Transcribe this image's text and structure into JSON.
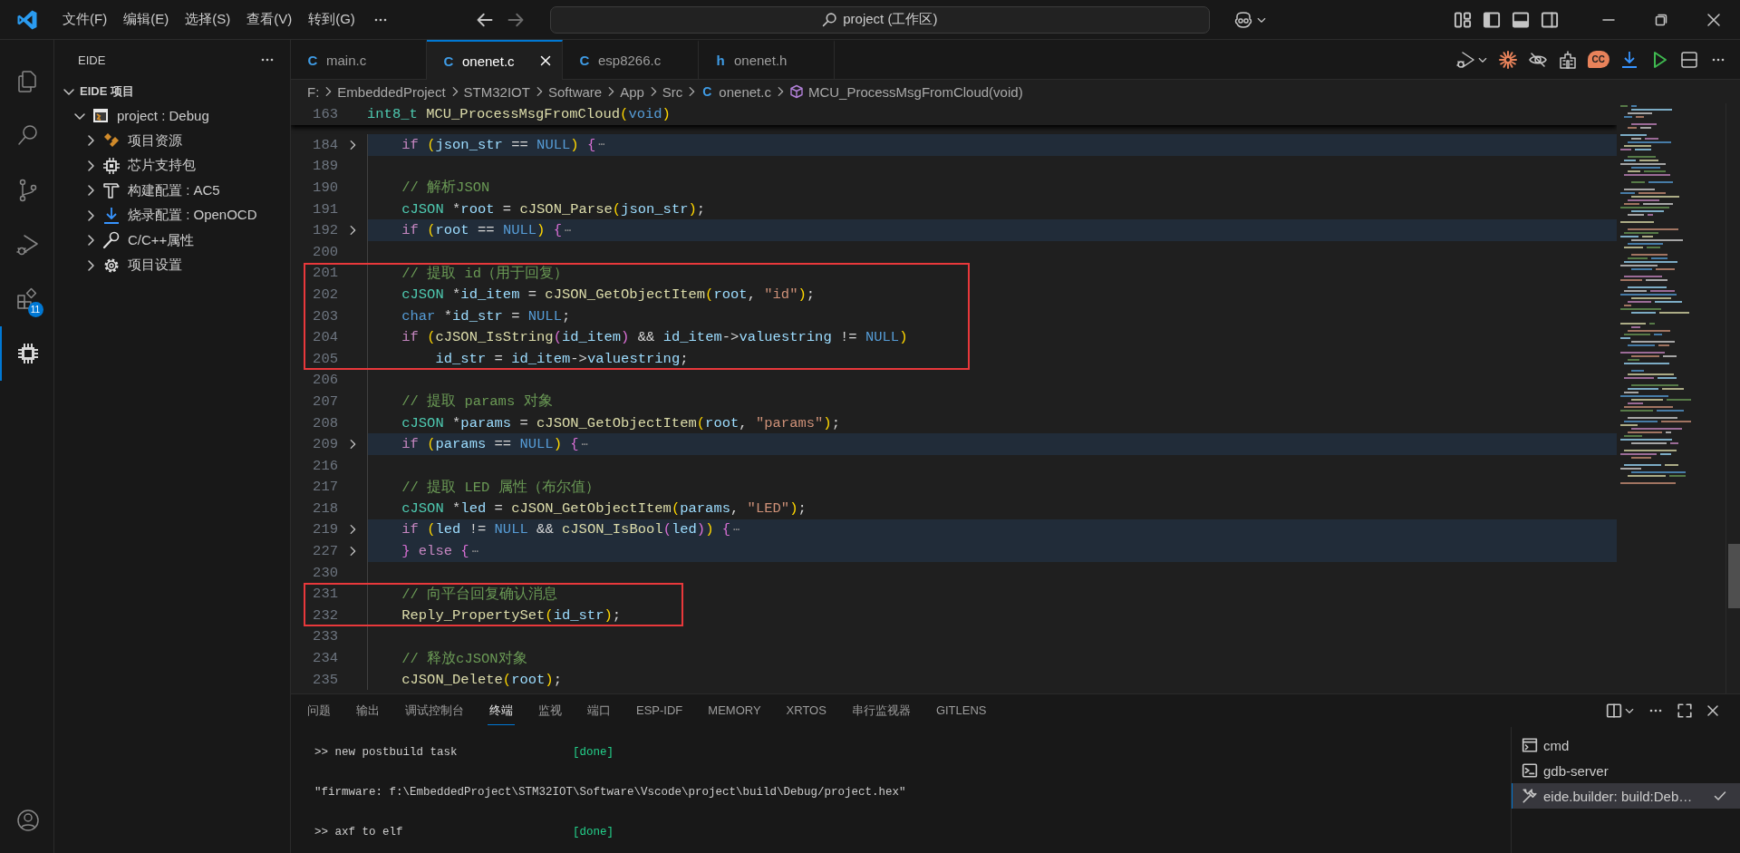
{
  "title_bar": {
    "menus": [
      "文件(F)",
      "编辑(E)",
      "选择(S)",
      "查看(V)",
      "转到(G)"
    ],
    "command_center": "project (工作区)"
  },
  "activity_bar": {
    "items": [
      {
        "kind": "explorer",
        "selected": false
      },
      {
        "kind": "search",
        "selected": false
      },
      {
        "kind": "source_control",
        "selected": false
      },
      {
        "kind": "run_debug",
        "selected": false
      },
      {
        "kind": "extensions",
        "selected": false,
        "badge": "11"
      },
      {
        "kind": "eide",
        "selected": true
      }
    ]
  },
  "sidebar": {
    "title": "EIDE",
    "section": {
      "label": "EIDE 项目",
      "expanded": true
    },
    "tree": [
      {
        "label": "project : Debug",
        "kind": "project",
        "expanded": true,
        "children": [
          {
            "label": "项目资源",
            "kind": "resources",
            "expanded": false
          },
          {
            "label": "芯片支持包",
            "kind": "chip",
            "expanded": false
          },
          {
            "label": "构建配置 : AC5",
            "kind": "build",
            "expanded": false
          },
          {
            "label": "烧录配置 : OpenOCD",
            "kind": "flash",
            "expanded": false
          },
          {
            "label": "C/C++属性",
            "kind": "key",
            "expanded": false
          },
          {
            "label": "项目设置",
            "kind": "settings",
            "expanded": false
          }
        ]
      }
    ]
  },
  "editor": {
    "tabs": [
      {
        "icon": "C",
        "label": "main.c",
        "selected": false
      },
      {
        "icon": "C",
        "label": "onenet.c",
        "selected": true
      },
      {
        "icon": "C",
        "label": "esp8266.c",
        "selected": false
      },
      {
        "icon": "h",
        "label": "onenet.h",
        "selected": false
      }
    ],
    "toolbar": {
      "bubble_label": "CC"
    },
    "breadcrumb": [
      {
        "kind": "folder",
        "label": "F:"
      },
      {
        "kind": "folder",
        "label": "EmbeddedProject"
      },
      {
        "kind": "folder",
        "label": "STM32IOT"
      },
      {
        "kind": "folder",
        "label": "Software"
      },
      {
        "kind": "folder",
        "label": "App"
      },
      {
        "kind": "folder",
        "label": "Src"
      },
      {
        "kind": "file",
        "icon": "C",
        "label": "onenet.c"
      },
      {
        "kind": "symbol",
        "label": "MCU_ProcessMsgFromCloud(void)"
      }
    ],
    "sticky_line": {
      "num": "163",
      "tokens": [
        {
          "kind": "type",
          "text": "int8_t "
        },
        {
          "kind": "function",
          "text": "MCU_ProcessMsgFromCloud"
        },
        {
          "kind": "bracket1",
          "text": "("
        },
        {
          "kind": "constant",
          "text": "void"
        },
        {
          "kind": "bracket1",
          "text": ")"
        }
      ]
    },
    "lines": [
      {
        "num": "184",
        "folded": true,
        "framed": false,
        "tokens": [
          {
            "kind": "keyword",
            "text": "    if "
          },
          {
            "kind": "bracket1",
            "text": "("
          },
          {
            "kind": "variable",
            "text": "json_str"
          },
          {
            "kind": "plain",
            "text": " == "
          },
          {
            "kind": "constant",
            "text": "NULL"
          },
          {
            "kind": "bracket1",
            "text": ") "
          },
          {
            "kind": "bracket2",
            "text": "{"
          },
          {
            "kind": "fold",
            "text": "⋯"
          }
        ]
      },
      {
        "num": "189",
        "folded": false,
        "framed": false
      },
      {
        "num": "190",
        "folded": false,
        "framed": false,
        "tokens": [
          {
            "kind": "comment",
            "text": "    // 解析JSON"
          }
        ]
      },
      {
        "num": "191",
        "folded": false,
        "framed": false,
        "tokens": [
          {
            "kind": "type",
            "text": "    cJSON"
          },
          {
            "kind": "plain",
            "text": " *"
          },
          {
            "kind": "variable",
            "text": "root"
          },
          {
            "kind": "plain",
            "text": " = "
          },
          {
            "kind": "function",
            "text": "cJSON_Parse"
          },
          {
            "kind": "bracket1",
            "text": "("
          },
          {
            "kind": "variable",
            "text": "json_str"
          },
          {
            "kind": "bracket1",
            "text": ")"
          },
          {
            "kind": "plain",
            "text": ";"
          }
        ]
      },
      {
        "num": "192",
        "folded": true,
        "framed": false,
        "tokens": [
          {
            "kind": "keyword",
            "text": "    if "
          },
          {
            "kind": "bracket1",
            "text": "("
          },
          {
            "kind": "variable",
            "text": "root"
          },
          {
            "kind": "plain",
            "text": " == "
          },
          {
            "kind": "constant",
            "text": "NULL"
          },
          {
            "kind": "bracket1",
            "text": ") "
          },
          {
            "kind": "bracket2",
            "text": "{"
          },
          {
            "kind": "fold",
            "text": "⋯"
          }
        ]
      },
      {
        "num": "200",
        "folded": false,
        "framed": false
      },
      {
        "num": "201",
        "folded": false,
        "framed": true,
        "tokens": [
          {
            "kind": "comment",
            "text": "    // 提取 id（用于回复）"
          }
        ]
      },
      {
        "num": "202",
        "folded": false,
        "framed": true,
        "tokens": [
          {
            "kind": "type",
            "text": "    cJSON"
          },
          {
            "kind": "plain",
            "text": " *"
          },
          {
            "kind": "variable",
            "text": "id_item"
          },
          {
            "kind": "plain",
            "text": " = "
          },
          {
            "kind": "function",
            "text": "cJSON_GetObjectItem"
          },
          {
            "kind": "bracket1",
            "text": "("
          },
          {
            "kind": "variable",
            "text": "root"
          },
          {
            "kind": "plain",
            "text": ", "
          },
          {
            "kind": "string",
            "text": "\"id\""
          },
          {
            "kind": "bracket1",
            "text": ")"
          },
          {
            "kind": "plain",
            "text": ";"
          }
        ]
      },
      {
        "num": "203",
        "folded": false,
        "framed": true,
        "tokens": [
          {
            "kind": "constant",
            "text": "    char"
          },
          {
            "kind": "plain",
            "text": " *"
          },
          {
            "kind": "variable",
            "text": "id_str"
          },
          {
            "kind": "plain",
            "text": " = "
          },
          {
            "kind": "constant",
            "text": "NULL"
          },
          {
            "kind": "plain",
            "text": ";"
          }
        ]
      },
      {
        "num": "204",
        "folded": false,
        "framed": true,
        "tokens": [
          {
            "kind": "keyword",
            "text": "    if "
          },
          {
            "kind": "bracket1",
            "text": "("
          },
          {
            "kind": "function",
            "text": "cJSON_IsString"
          },
          {
            "kind": "bracket2",
            "text": "("
          },
          {
            "kind": "variable",
            "text": "id_item"
          },
          {
            "kind": "bracket2",
            "text": ")"
          },
          {
            "kind": "plain",
            "text": " && "
          },
          {
            "kind": "variable",
            "text": "id_item"
          },
          {
            "kind": "plain",
            "text": "->"
          },
          {
            "kind": "variable",
            "text": "valuestring"
          },
          {
            "kind": "plain",
            "text": " != "
          },
          {
            "kind": "constant",
            "text": "NULL"
          },
          {
            "kind": "bracket1",
            "text": ")"
          }
        ]
      },
      {
        "num": "205",
        "folded": false,
        "framed": true,
        "tokens": [
          {
            "kind": "variable",
            "text": "        id_str"
          },
          {
            "kind": "plain",
            "text": " = "
          },
          {
            "kind": "variable",
            "text": "id_item"
          },
          {
            "kind": "plain",
            "text": "->"
          },
          {
            "kind": "variable",
            "text": "valuestring"
          },
          {
            "kind": "plain",
            "text": ";"
          }
        ]
      },
      {
        "num": "206",
        "folded": false,
        "framed": false
      },
      {
        "num": "207",
        "folded": false,
        "framed": false,
        "tokens": [
          {
            "kind": "comment",
            "text": "    // 提取 params 对象"
          }
        ]
      },
      {
        "num": "208",
        "folded": false,
        "framed": false,
        "tokens": [
          {
            "kind": "type",
            "text": "    cJSON"
          },
          {
            "kind": "plain",
            "text": " *"
          },
          {
            "kind": "variable",
            "text": "params"
          },
          {
            "kind": "plain",
            "text": " = "
          },
          {
            "kind": "function",
            "text": "cJSON_GetObjectItem"
          },
          {
            "kind": "bracket1",
            "text": "("
          },
          {
            "kind": "variable",
            "text": "root"
          },
          {
            "kind": "plain",
            "text": ", "
          },
          {
            "kind": "string",
            "text": "\"params\""
          },
          {
            "kind": "bracket1",
            "text": ")"
          },
          {
            "kind": "plain",
            "text": ";"
          }
        ]
      },
      {
        "num": "209",
        "folded": true,
        "framed": false,
        "tokens": [
          {
            "kind": "keyword",
            "text": "    if "
          },
          {
            "kind": "bracket1",
            "text": "("
          },
          {
            "kind": "variable",
            "text": "params"
          },
          {
            "kind": "plain",
            "text": " == "
          },
          {
            "kind": "constant",
            "text": "NULL"
          },
          {
            "kind": "bracket1",
            "text": ") "
          },
          {
            "kind": "bracket2",
            "text": "{"
          },
          {
            "kind": "fold",
            "text": "⋯"
          }
        ]
      },
      {
        "num": "216",
        "folded": false,
        "framed": false
      },
      {
        "num": "217",
        "folded": false,
        "framed": false,
        "tokens": [
          {
            "kind": "comment",
            "text": "    // 提取 LED 属性（布尔值）"
          }
        ]
      },
      {
        "num": "218",
        "folded": false,
        "framed": false,
        "tokens": [
          {
            "kind": "type",
            "text": "    cJSON"
          },
          {
            "kind": "plain",
            "text": " *"
          },
          {
            "kind": "variable",
            "text": "led"
          },
          {
            "kind": "plain",
            "text": " = "
          },
          {
            "kind": "function",
            "text": "cJSON_GetObjectItem"
          },
          {
            "kind": "bracket1",
            "text": "("
          },
          {
            "kind": "variable",
            "text": "params"
          },
          {
            "kind": "plain",
            "text": ", "
          },
          {
            "kind": "string",
            "text": "\"LED\""
          },
          {
            "kind": "bracket1",
            "text": ")"
          },
          {
            "kind": "plain",
            "text": ";"
          }
        ]
      },
      {
        "num": "219",
        "folded": true,
        "framed": false,
        "tokens": [
          {
            "kind": "keyword",
            "text": "    if "
          },
          {
            "kind": "bracket1",
            "text": "("
          },
          {
            "kind": "variable",
            "text": "led"
          },
          {
            "kind": "plain",
            "text": " != "
          },
          {
            "kind": "constant",
            "text": "NULL"
          },
          {
            "kind": "plain",
            "text": " && "
          },
          {
            "kind": "function",
            "text": "cJSON_IsBool"
          },
          {
            "kind": "bracket2",
            "text": "("
          },
          {
            "kind": "variable",
            "text": "led"
          },
          {
            "kind": "bracket2",
            "text": ")"
          },
          {
            "kind": "bracket1",
            "text": ") "
          },
          {
            "kind": "bracket2",
            "text": "{"
          },
          {
            "kind": "fold",
            "text": "⋯"
          }
        ]
      },
      {
        "num": "227",
        "folded": true,
        "framed": false,
        "tokens": [
          {
            "kind": "bracket2",
            "text": "    } "
          },
          {
            "kind": "keyword",
            "text": "else "
          },
          {
            "kind": "bracket2",
            "text": "{"
          },
          {
            "kind": "fold",
            "text": "⋯"
          }
        ]
      },
      {
        "num": "230",
        "folded": false,
        "framed": false
      },
      {
        "num": "231",
        "folded": false,
        "framed": true,
        "tokens": [
          {
            "kind": "comment",
            "text": "    // 向平台回复确认消息"
          }
        ]
      },
      {
        "num": "232",
        "folded": false,
        "framed": true,
        "tokens": [
          {
            "kind": "function",
            "text": "    Reply_PropertySet"
          },
          {
            "kind": "bracket1",
            "text": "("
          },
          {
            "kind": "variable",
            "text": "id_str"
          },
          {
            "kind": "bracket1",
            "text": ")"
          },
          {
            "kind": "plain",
            "text": ";"
          }
        ]
      },
      {
        "num": "233",
        "folded": false,
        "framed": false
      },
      {
        "num": "234",
        "folded": false,
        "framed": false,
        "tokens": [
          {
            "kind": "comment",
            "text": "    // 释放cJSON对象"
          }
        ]
      },
      {
        "num": "235",
        "folded": false,
        "framed": false,
        "tokens": [
          {
            "kind": "function",
            "text": "    cJSON_Delete"
          },
          {
            "kind": "bracket1",
            "text": "("
          },
          {
            "kind": "variable",
            "text": "root"
          },
          {
            "kind": "bracket1",
            "text": ")"
          },
          {
            "kind": "plain",
            "text": ";"
          }
        ]
      }
    ]
  },
  "panel": {
    "tabs": [
      {
        "label": "问题",
        "selected": false
      },
      {
        "label": "输出",
        "selected": false
      },
      {
        "label": "调试控制台",
        "selected": false
      },
      {
        "label": "终端",
        "selected": true
      },
      {
        "label": "监视",
        "selected": false
      },
      {
        "label": "端口",
        "selected": false
      },
      {
        "label": "ESP-IDF",
        "selected": false
      },
      {
        "label": "MEMORY",
        "selected": false
      },
      {
        "label": "XRTOS",
        "selected": false
      },
      {
        "label": "串行监视器",
        "selected": false
      },
      {
        "label": "GITLENS",
        "selected": false
      }
    ],
    "terminal_lines": [
      {
        "text": ">> new postbuild task",
        "status": "[done]"
      },
      {
        "text": "\"firmware: f:\\EmbeddedProject\\STM32IOT\\Software\\Vscode\\project\\build\\Debug/project.hex\""
      },
      {
        "text": ">> axf to elf",
        "status": "[done]"
      }
    ],
    "terminals": [
      {
        "kind": "cmd",
        "label": "cmd",
        "selected": false,
        "task_done": false
      },
      {
        "kind": "shell",
        "label": "gdb-server",
        "selected": false,
        "task_done": false
      },
      {
        "kind": "tool",
        "label": "eide.builder: build:Deb…",
        "selected": true,
        "task_done": true
      }
    ]
  }
}
